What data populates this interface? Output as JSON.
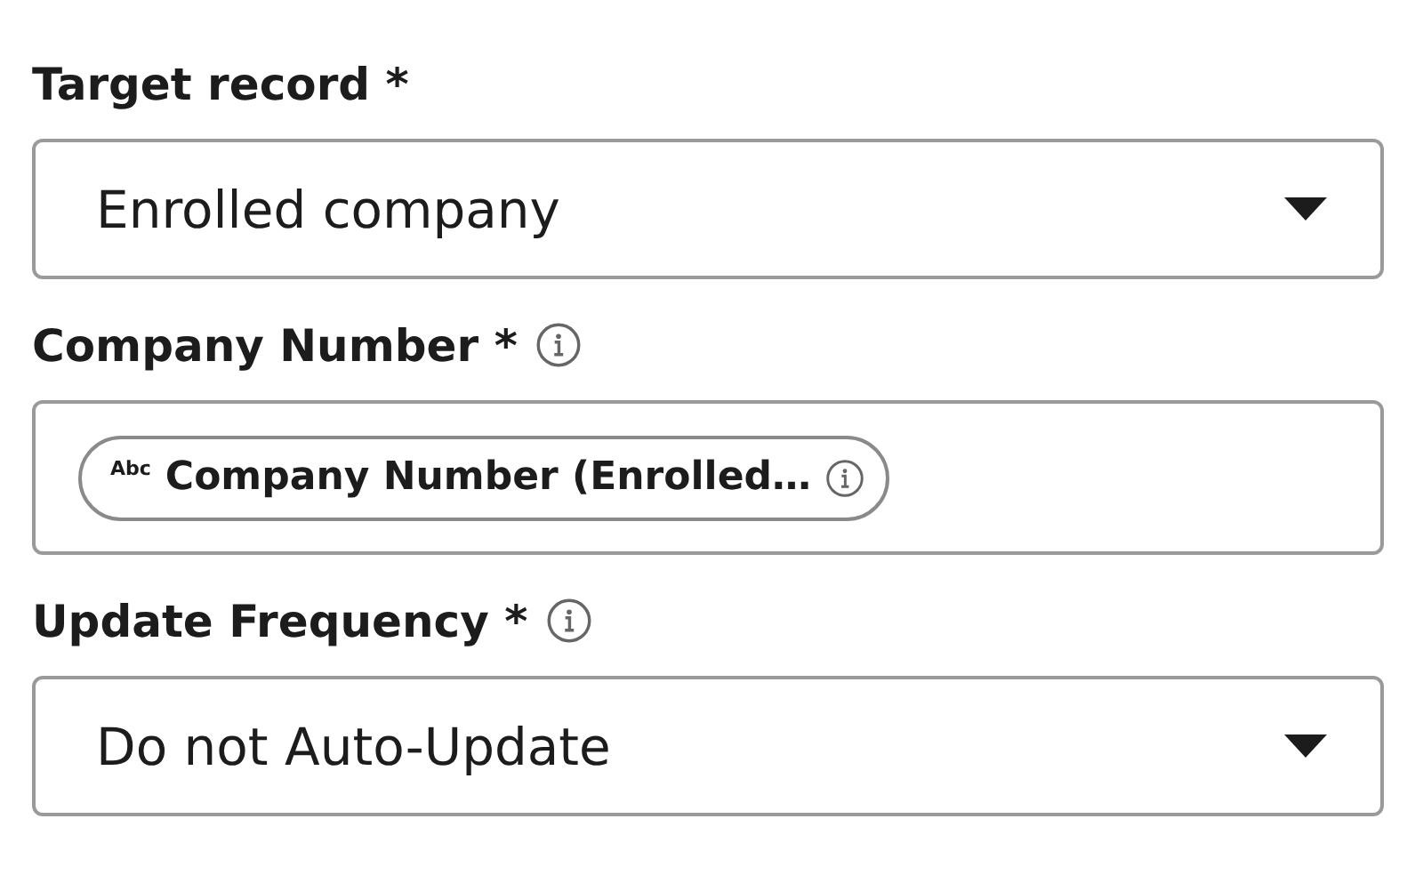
{
  "fields": [
    {
      "kind": "select",
      "label": "Target record",
      "required_mark": "*",
      "info": false,
      "value": "Enrolled company"
    },
    {
      "kind": "token",
      "label": "Company Number",
      "required_mark": "*",
      "info": true,
      "token": {
        "type_tag": "Abc",
        "text": "Company Number (Enrolled…",
        "info": true
      }
    },
    {
      "kind": "select",
      "label": "Update Frequency",
      "required_mark": "*",
      "info": true,
      "value": "Do not Auto-Update"
    }
  ]
}
